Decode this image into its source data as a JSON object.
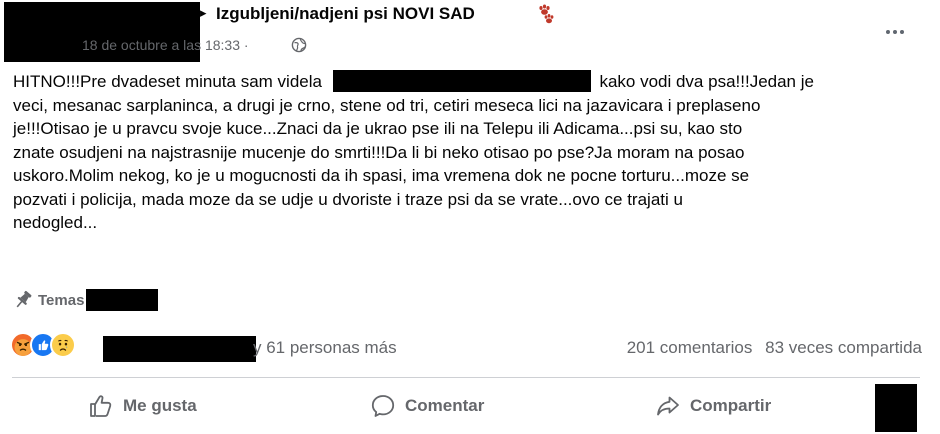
{
  "header": {
    "group_name": "Izgubljeni/nadjeni psi NOVI SAD",
    "arrow": "▸",
    "timestamp": "18 de octubre a las 18:33",
    "separator": "·",
    "privacy_icon": "globe-icon",
    "group_emoji_icon": "paw-prints-icon",
    "more_icon": "more-options-icon"
  },
  "post": {
    "lines": [
      {
        "before": "HITNO!!!Pre dvadeset minuta sam videla",
        "after": "kako vodi dva psa!!!Jedan je"
      },
      {
        "text": "veci, mesanac sarplaninca, a drugi je crno, stene od tri, cetiri meseca lici na jazavicara i preplaseno"
      },
      {
        "text": "je!!!Otisao je u pravcu svoje kuce...Znaci da je ukrao pse ili na Telepu ili Adicama...psi su, kao sto"
      },
      {
        "text": "znate osudjeni na najstrasnije mucenje do smrti!!!Da li bi neko otisao po pse?Ja moram na posao"
      },
      {
        "text": "uskoro.Molim nekog, ko je u mogucnosti da ih spasi, ima vremena dok ne pocne torturu...moze se"
      },
      {
        "text": "pozvati i policija, mada moze da se udje u dvoriste i traze psi da se vrate...ovo ce trajati u"
      },
      {
        "text": "nedogled..."
      }
    ]
  },
  "topics": {
    "label": "Temas",
    "icon": "pin-icon"
  },
  "engagement": {
    "reactions": [
      "angry",
      "like",
      "sad"
    ],
    "reactions_text": "y 61 personas más",
    "comments": "201 comentarios",
    "shares": "83 veces compartida"
  },
  "actions": {
    "like_label": "Me gusta",
    "comment_label": "Comentar",
    "share_label": "Compartir"
  },
  "colors": {
    "text_primary": "#050505",
    "text_secondary": "#65676b",
    "like_blue": "#1877f2",
    "angry_orange": "#f26a2a",
    "sad_yellow": "#fbcc4a",
    "divider": "#ced0d4"
  }
}
